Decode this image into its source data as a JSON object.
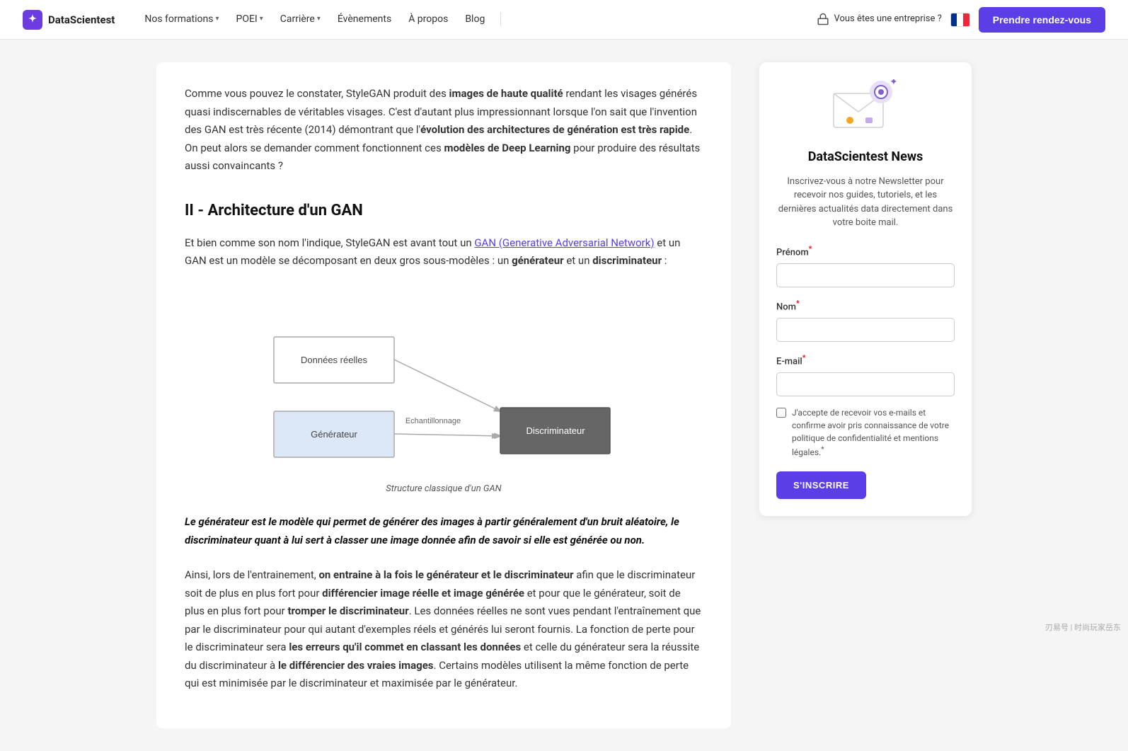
{
  "nav": {
    "logo_text": "DataScientest",
    "nos_formations": "Nos formations",
    "poei": "POEI",
    "carriere": "Carrière",
    "evenements": "Évènements",
    "a_propos": "À propos",
    "blog": "Blog",
    "enterprise": "Vous êtes une entreprise ?",
    "cta": "Prendre rendez-vous"
  },
  "article": {
    "para1": "Comme vous pouvez le constater, StyleGAN produit des ",
    "para1_bold1": "images de haute qualité",
    "para1_rest": " rendant les visages générés quasi indiscernables de véritables visages. C'est d'autant plus impressionnant lorsque l'on sait que l'invention des GAN est très récente (2014) démontrant que l'",
    "para1_bold2": "évolution des architectures de génération est très rapide",
    "para1_end": ". On peut alors se demander comment fonctionnent ces ",
    "para1_bold3": "modèles de Deep Learning",
    "para1_tail": " pour produire des résultats aussi convaincants ?",
    "section_heading": "II - Architecture d'un GAN",
    "para2_start": "Et bien comme son nom l'indique, StyleGAN est avant tout un ",
    "para2_link": "GAN (Generative Adversarial Network)",
    "para2_rest": " et un GAN est un modèle se décomposant en deux gros sous-modèles : un ",
    "para2_bold1": "générateur",
    "para2_mid": " et un ",
    "para2_bold2": "discriminateur",
    "para2_end": " :",
    "diagram_caption": "Structure classique d'un GAN",
    "diagram_label_donnees": "Données réelles",
    "diagram_label_generateur": "Générateur",
    "diagram_label_echantillonnage": "Echantillonnage",
    "diagram_label_discriminateur": "Discriminateur",
    "blockquote": "Le générateur est le modèle qui permet de générer des images à partir généralement d'un bruit aléatoire, le discriminateur quant à lui sert à classer une image donnée afin de savoir si elle est générée ou non.",
    "para3_start": "Ainsi, lors de l'entrainement, ",
    "para3_bold1": "on entraine à la fois le générateur et le discriminateur",
    "para3_rest1": " afin que le discriminateur soit de plus en plus fort pour ",
    "para3_bold2": "différencier image réelle et image générée",
    "para3_rest2": " et pour que le générateur, soit de plus en plus fort pour ",
    "para3_bold3": "tromper le discriminateur",
    "para3_rest3": ". Les données réelles ne sont vues pendant l'entraînement que par le discriminateur pour qui autant d'exemples réels et générés lui seront fournis. La fonction de perte pour le discriminateur sera ",
    "para3_bold4": "les erreurs qu'il commet en classant les données",
    "para3_rest4": " et celle du générateur sera la réussite du discriminateur à ",
    "para3_bold5": "le différencier des vraies images",
    "para3_end": ". Certains modèles utilisent la même fonction de perte qui est minimisée par le discriminateur et maximisée par le générateur."
  },
  "sidebar": {
    "title": "DataScientest News",
    "description": "Inscrivez-vous à notre Newsletter pour recevoir nos guides, tutoriels, et les dernières actualités data directement dans votre boite mail.",
    "field_prenom": "Prénom",
    "field_nom": "Nom",
    "field_email": "E-mail",
    "required_marker": "*",
    "checkbox_text": "J'accepte de recevoir vos e-mails et confirme avoir pris connaissance de votre politique de confidentialité et mentions légales.",
    "submit_label": "S'INSCRIRE"
  },
  "watermark": "刃易号 | 时尚玩家岳东"
}
